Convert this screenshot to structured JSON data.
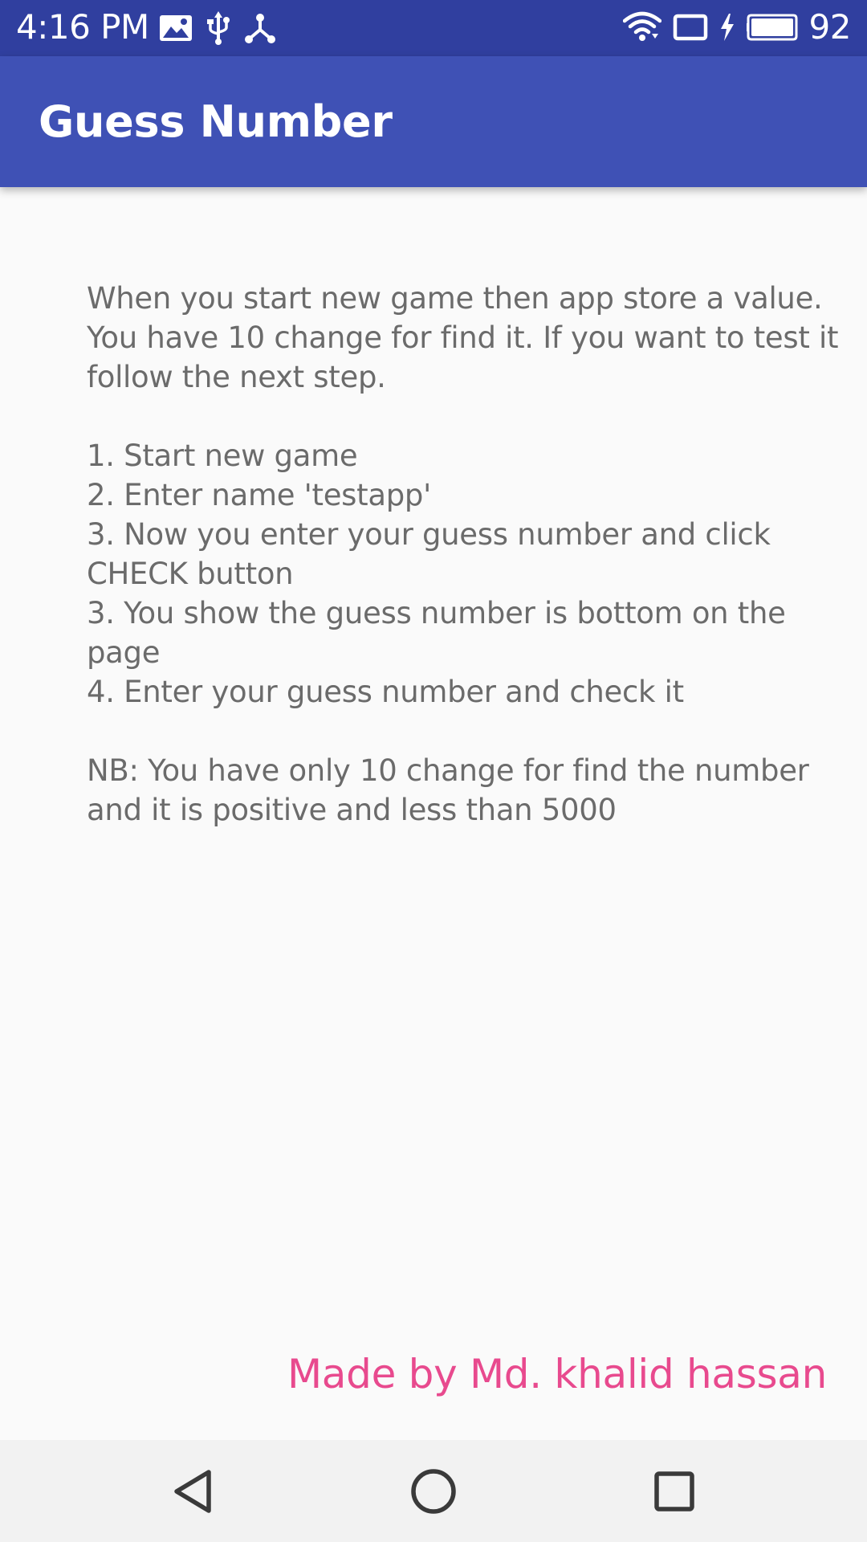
{
  "status_bar": {
    "time": "4:16 PM",
    "battery_percent": "92",
    "left_icons": [
      "gallery-icon",
      "usb-icon",
      "share-icon"
    ],
    "right_icons": [
      "wifi-icon",
      "cast-icon",
      "charging-icon",
      "battery-icon"
    ]
  },
  "app_bar": {
    "title": "Guess Number",
    "color": "#3f51b5",
    "status_color": "#303f9f"
  },
  "content": {
    "intro": "When you start new game then app store a value. You have 10 change for find it. If you want to test it follow the next step.",
    "steps": [
      "1. Start new game",
      "2. Enter name 'testapp'",
      "3. Now you enter your guess number and click CHECK button",
      "3. You show the guess number is bottom on the page",
      "4. Enter your guess number and check it"
    ],
    "note": "NB: You have only 10 change for find the number and it is positive and less than 5000",
    "text_color": "#6b6b6b"
  },
  "footer": {
    "credit": "Made by Md. khalid hassan",
    "credit_color": "#e84a8e"
  },
  "nav_bar": {
    "buttons": [
      "back-icon",
      "home-icon",
      "recents-icon"
    ]
  }
}
